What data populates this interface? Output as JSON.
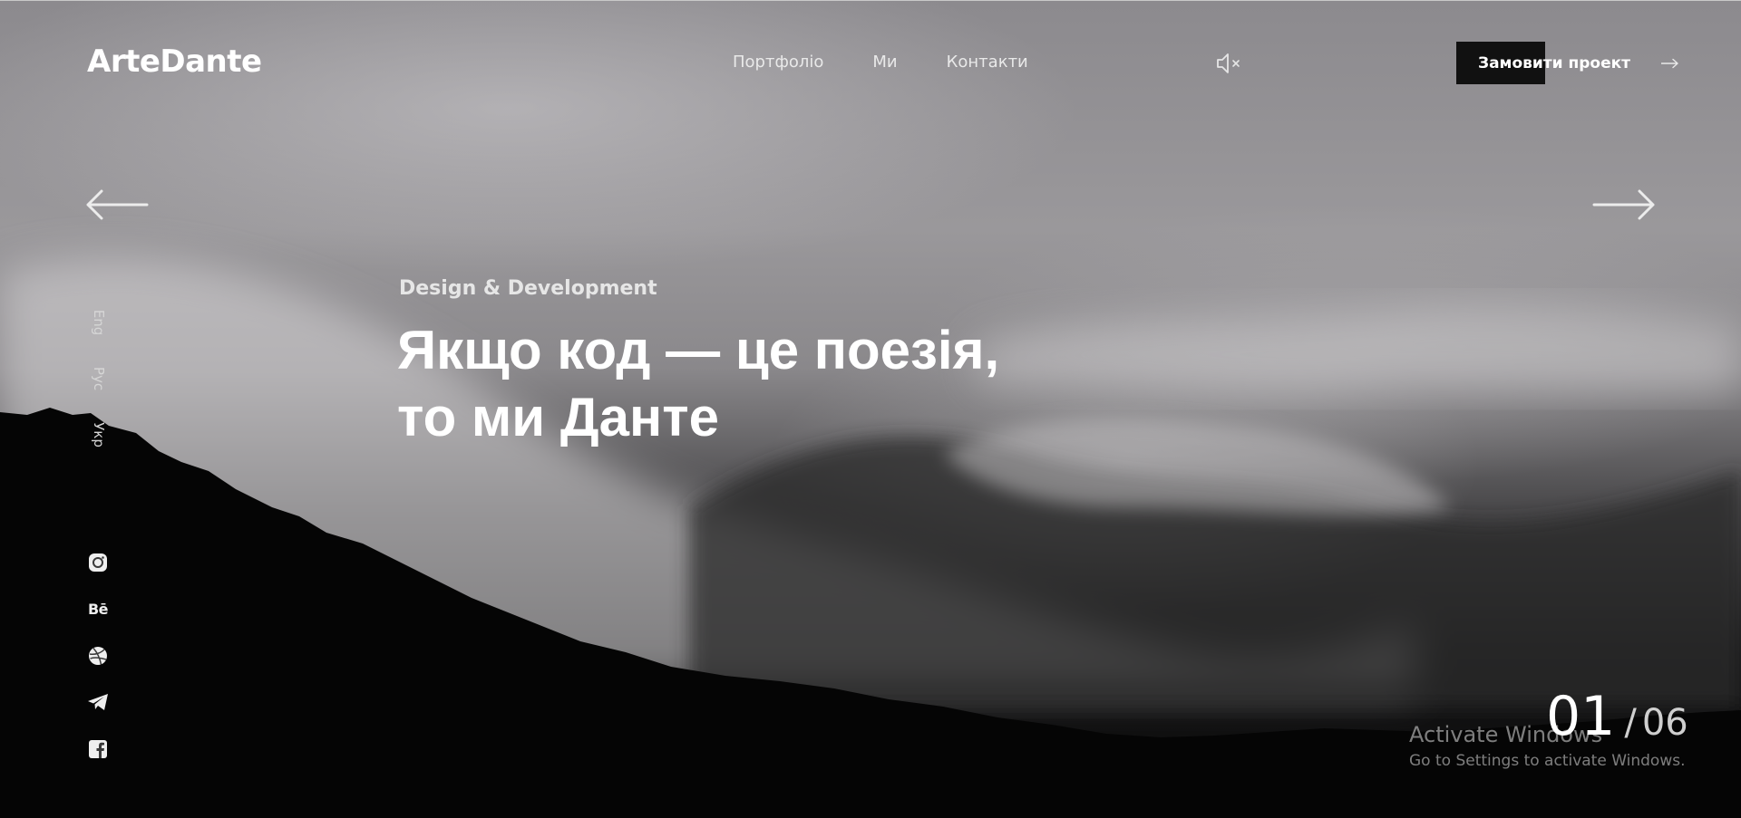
{
  "header": {
    "logo": "ArteDante",
    "nav": [
      "Портфоліо",
      "Ми",
      "Контакти"
    ],
    "sound_icon": "speaker-muted-icon",
    "cta_label": "Замовити проект",
    "cta_icon": "arrow-right-icon"
  },
  "slider": {
    "prev_icon": "arrow-left-icon",
    "next_icon": "arrow-right-icon",
    "current": "01",
    "separator": "/",
    "total": "06"
  },
  "languages": [
    "Eng",
    "Рус",
    "Укр"
  ],
  "hero": {
    "subtitle": "Design & Development",
    "headline_line1": "Якщо код — це поезія,",
    "headline_line2": "то ми Данте"
  },
  "social": [
    "instagram-icon",
    "behance-icon",
    "dribbble-icon",
    "telegram-icon",
    "facebook-icon"
  ],
  "behance_label": "Bē",
  "watermark": {
    "title": "Activate Windows",
    "subtitle": "Go to Settings to activate Windows."
  },
  "colors": {
    "cta_background": "#111111",
    "text": "#ffffff"
  }
}
